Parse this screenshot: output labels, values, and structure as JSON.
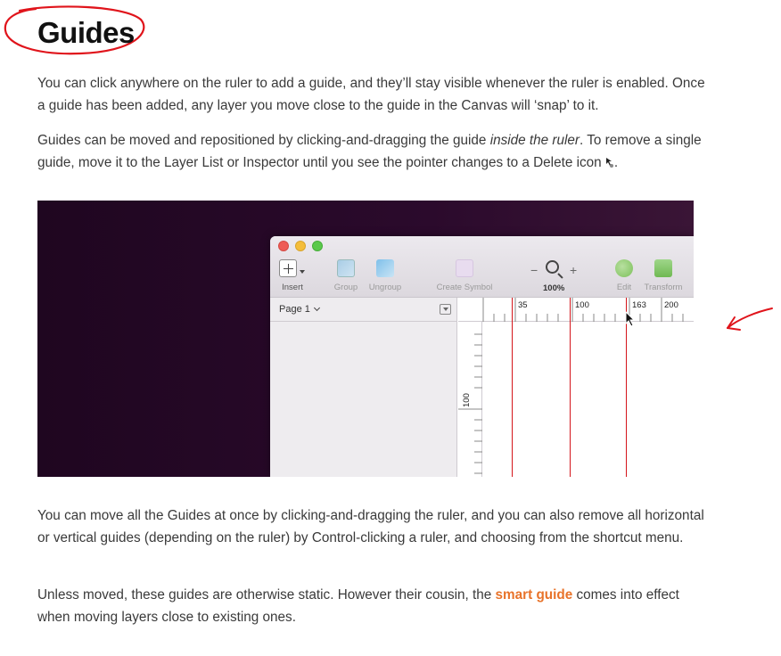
{
  "page": {
    "title": "Guides",
    "para1": "You can click anywhere on the ruler to add a guide, and they’ll stay visible whenever the ruler is enabled. Once a guide has been added, any layer you move close to the guide in the Canvas will ‘snap’ to it.",
    "para2_before": "Guides can be moved and repositioned by clicking-and-dragging the guide ",
    "para2_em": "inside the ruler",
    "para2_after": ". To remove a single guide, move it to the Layer List or Inspector until you see the pointer changes to a Delete icon ",
    "para2_end": ".",
    "para3": "You can move all the Guides at once by clicking-and-dragging the ruler, and you can also remove all horizontal or vertical guides (depending on the ruler) by Control-clicking a ruler, and choosing from the shortcut menu.",
    "para4_before": "Unless moved, these guides are otherwise static. However their cousin, the ",
    "para4_link": "smart guide",
    "para4_after": " comes into effect when moving layers close to existing ones."
  },
  "screenshot": {
    "toolbar": {
      "insert": "Insert",
      "group": "Group",
      "ungroup": "Ungroup",
      "create_symbol": "Create Symbol",
      "zoom_minus": "−",
      "zoom_plus": "+",
      "zoom_level": "100%",
      "edit": "Edit",
      "transform": "Transform"
    },
    "sidebar": {
      "page_selector": "Page 1"
    },
    "ruler": {
      "top_ticks": [
        "35",
        "100",
        "163",
        "200"
      ],
      "left_tick": "100"
    }
  },
  "colors": {
    "accent_link": "#e8732a",
    "guide_red": "#d4151b",
    "annotation_red": "#e0141b"
  }
}
